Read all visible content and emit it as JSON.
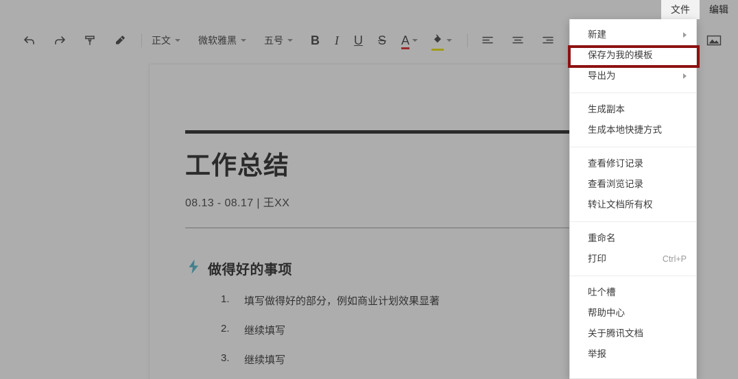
{
  "menubar": {
    "items": [
      {
        "label": "文件",
        "active": true
      },
      {
        "label": "编辑",
        "active": false
      }
    ]
  },
  "toolbar": {
    "undo": "undo-arrow",
    "redo": "redo-arrow",
    "format_painter": "format-painter",
    "clear_format": "eraser",
    "style_select": {
      "value": "正文"
    },
    "font_select": {
      "value": "微软雅黑"
    },
    "size_select": {
      "value": "五号"
    },
    "bold": "B",
    "italic": "I",
    "underline": "U",
    "strikethrough": "S",
    "text_color": {
      "glyph": "A",
      "color": "#e02020"
    },
    "highlight_color": {
      "glyph": "bucket",
      "color": "#e8e000"
    },
    "align_left": "align-left",
    "align_center": "align-center",
    "align_right": "align-right",
    "insert_image": "image"
  },
  "document": {
    "title": "工作总结",
    "subtitle": "08.13 - 08.17 | 王XX",
    "section": {
      "icon": "lightning-bolt",
      "icon_color": "#45b5c4",
      "title": "做得好的事项",
      "items": [
        {
          "num": "1.",
          "text": "填写做得好的部分，例如商业计划效果显著"
        },
        {
          "num": "2.",
          "text": "继续填写"
        },
        {
          "num": "3.",
          "text": "继续填写"
        }
      ]
    }
  },
  "file_menu": {
    "highlight_color": "#8d1111",
    "groups": [
      {
        "items": [
          {
            "label": "新建",
            "submenu": true,
            "shortcut": "",
            "highlighted": false
          },
          {
            "label": "保存为我的模板",
            "submenu": false,
            "shortcut": "",
            "highlighted": true
          },
          {
            "label": "导出为",
            "submenu": true,
            "shortcut": "",
            "highlighted": false
          }
        ]
      },
      {
        "items": [
          {
            "label": "生成副本",
            "submenu": false,
            "shortcut": "",
            "highlighted": false
          },
          {
            "label": "生成本地快捷方式",
            "submenu": false,
            "shortcut": "",
            "highlighted": false
          }
        ]
      },
      {
        "items": [
          {
            "label": "查看修订记录",
            "submenu": false,
            "shortcut": "",
            "highlighted": false
          },
          {
            "label": "查看浏览记录",
            "submenu": false,
            "shortcut": "",
            "highlighted": false
          },
          {
            "label": "转让文档所有权",
            "submenu": false,
            "shortcut": "",
            "highlighted": false
          }
        ]
      },
      {
        "items": [
          {
            "label": "重命名",
            "submenu": false,
            "shortcut": "",
            "highlighted": false
          },
          {
            "label": "打印",
            "submenu": false,
            "shortcut": "Ctrl+P",
            "highlighted": false
          }
        ]
      },
      {
        "items": [
          {
            "label": "吐个槽",
            "submenu": false,
            "shortcut": "",
            "highlighted": false
          },
          {
            "label": "帮助中心",
            "submenu": false,
            "shortcut": "",
            "highlighted": false
          },
          {
            "label": "关于腾讯文档",
            "submenu": false,
            "shortcut": "",
            "highlighted": false
          },
          {
            "label": "举报",
            "submenu": false,
            "shortcut": "",
            "highlighted": false
          }
        ]
      }
    ]
  }
}
